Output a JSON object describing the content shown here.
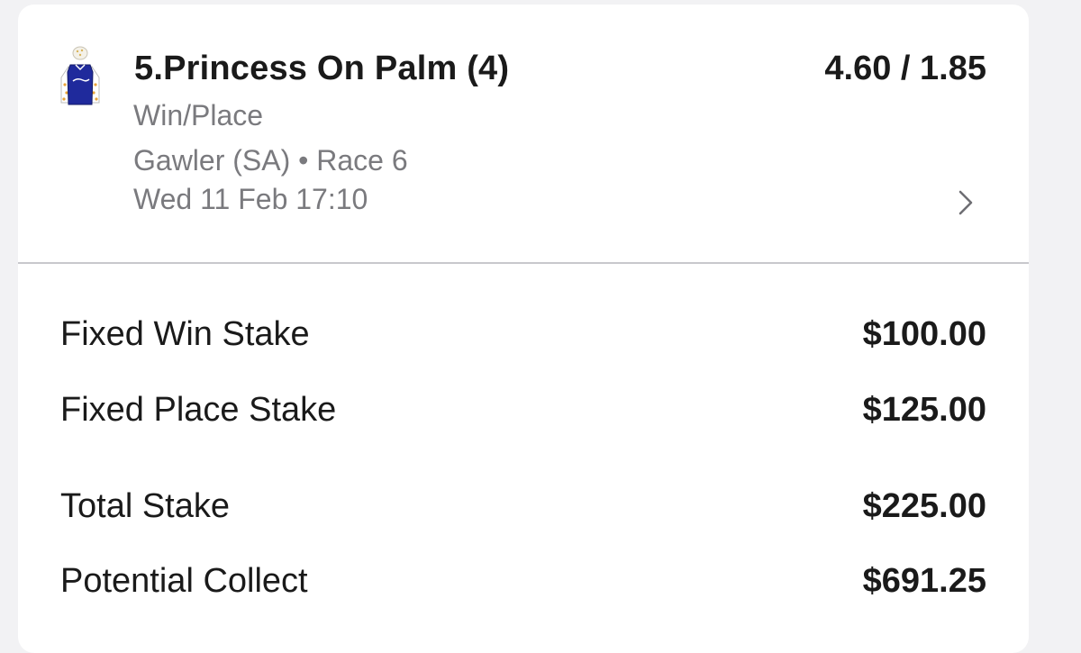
{
  "selection": {
    "runner_name": "5.Princess On Palm (4)",
    "odds": "4.60 / 1.85",
    "bet_type": "Win/Place",
    "venue_race": "Gawler (SA) • Race 6",
    "datetime": "Wed 11 Feb 17:10",
    "silks_icon": "jockey-silks-icon",
    "chevron_icon": "chevron-right-icon"
  },
  "stakes": [
    {
      "label": "Fixed Win Stake",
      "value": "$100.00"
    },
    {
      "label": "Fixed Place Stake",
      "value": "$125.00"
    },
    {
      "label": "Total Stake",
      "value": "$225.00"
    },
    {
      "label": "Potential Collect",
      "value": "$691.25"
    }
  ],
  "colors": {
    "silks_blue": "#1f2a9c",
    "silks_white": "#ffffff",
    "silks_dots": "#e8a33a",
    "muted_text": "#7a7a7e"
  }
}
